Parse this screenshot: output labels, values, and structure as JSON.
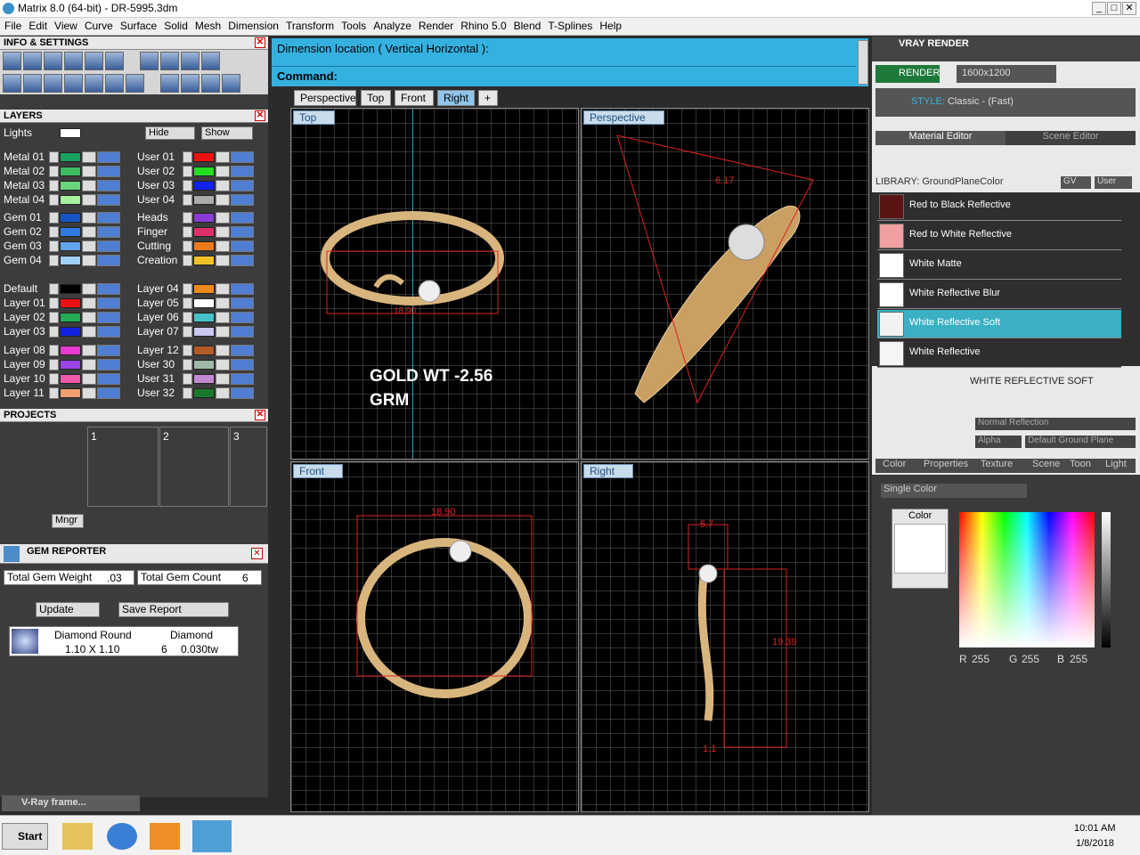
{
  "app": {
    "title": "Matrix 8.0 (64-bit) - DR-5995.3dm"
  },
  "menu": [
    "File",
    "Edit",
    "View",
    "Curve",
    "Surface",
    "Solid",
    "Mesh",
    "Dimension",
    "Transform",
    "Tools",
    "Analyze",
    "Render",
    "Rhino 5.0",
    "Blend",
    "T-Splines",
    "Help"
  ],
  "info": {
    "header": "INFO & SETTINGS"
  },
  "layers": {
    "header": "LAYERS",
    "lights": "Lights",
    "hide": "Hide",
    "show": "Show",
    "group1": [
      {
        "n": "Metal 01",
        "c": "#1aa060"
      },
      {
        "n": "Metal 02",
        "c": "#3cbb60"
      },
      {
        "n": "Metal 03",
        "c": "#6ad67b"
      },
      {
        "n": "Metal 04",
        "c": "#a8efa0"
      }
    ],
    "group1b": [
      {
        "n": "User 01",
        "c": "#ee1111"
      },
      {
        "n": "User 02",
        "c": "#22dd22"
      },
      {
        "n": "User 03",
        "c": "#1122ee"
      },
      {
        "n": "User 04",
        "c": "#aaaaaa"
      }
    ],
    "group2": [
      {
        "n": "Gem 01",
        "c": "#1755c7"
      },
      {
        "n": "Gem 02",
        "c": "#2f7ae0"
      },
      {
        "n": "Gem 03",
        "c": "#62a4ee"
      },
      {
        "n": "Gem 04",
        "c": "#9fd0f6"
      }
    ],
    "group2b": [
      {
        "n": "Heads",
        "c": "#8a3dd6"
      },
      {
        "n": "Finger",
        "c": "#dd2f66"
      },
      {
        "n": "Cutting",
        "c": "#ee7a1c"
      },
      {
        "n": "Creation",
        "c": "#f2c224"
      }
    ],
    "group3": [
      {
        "n": "Default",
        "c": "#000000"
      },
      {
        "n": "Layer 01",
        "c": "#ee1111"
      },
      {
        "n": "Layer 02",
        "c": "#22aa55"
      },
      {
        "n": "Layer 03",
        "c": "#1122dd"
      }
    ],
    "group3b": [
      {
        "n": "Layer 04",
        "c": "#ee8a1c"
      },
      {
        "n": "Layer 05",
        "c": "#ffffff"
      },
      {
        "n": "Layer 06",
        "c": "#46c3c8"
      },
      {
        "n": "Layer 07",
        "c": "#c8c8f0"
      }
    ],
    "group4": [
      {
        "n": "Layer 08",
        "c": "#e83ad0"
      },
      {
        "n": "Layer 09",
        "c": "#9b44e8"
      },
      {
        "n": "Layer 10",
        "c": "#ee5aaa"
      },
      {
        "n": "Layer 11",
        "c": "#f0a070"
      }
    ],
    "group4b": [
      {
        "n": "Layer 12",
        "c": "#b45a28"
      },
      {
        "n": "User 30",
        "c": "#9fb8a8"
      },
      {
        "n": "User 31",
        "c": "#c28ad0"
      },
      {
        "n": "User 32",
        "c": "#1a7a2a"
      }
    ]
  },
  "projects": {
    "header": "PROJECTS",
    "slots": [
      "1",
      "2",
      "3"
    ],
    "mngr": "Mngr"
  },
  "gem": {
    "header": "GEM REPORTER",
    "weight_label": "Total Gem Weight",
    "weight": ".03",
    "count_label": "Total Gem Count",
    "count": "6",
    "update": "Update",
    "save": "Save Report",
    "col1": "Diamond Round",
    "col2": "Diamond",
    "size": "1.10 X 1.10",
    "qty": "6",
    "wt": "0.030tw"
  },
  "vray_frame": "V-Ray frame...",
  "cmd": {
    "line1": "Dimension location ( Vertical  Horizontal ):",
    "line2": "Command:"
  },
  "tabs": [
    "Perspective",
    "Top",
    "Front",
    "Right"
  ],
  "viewports": {
    "top": "Top",
    "persp": "Perspective",
    "front": "Front",
    "right": "Right"
  },
  "annot": {
    "gold1": "GOLD WT -2.56",
    "gold2": "GRM",
    "d_top": "18.90",
    "d_front": "18.90",
    "d_right1": "5.7",
    "d_right2": "19.39",
    "d_right3": "1.1",
    "d_persp": "6.17"
  },
  "vray": {
    "title": "VRAY RENDER",
    "render": "RENDER",
    "res": "1600x1200",
    "style_label": "STYLE:",
    "style": "Classic - (Fast)",
    "tab_mat": "Material Editor",
    "tab_scene": "Scene Editor",
    "library": "LIBRARY: GroundPlaneColor",
    "gv": "GV",
    "user": "User",
    "materials": [
      {
        "n": "Red to Black Reflective",
        "c": "#5a1414"
      },
      {
        "n": "Red to White Reflective",
        "c": "#f0a0a0"
      },
      {
        "n": "White Matte",
        "c": "#ffffff"
      },
      {
        "n": "White Reflective Blur",
        "c": "#ffffff"
      },
      {
        "n": "White Reflective Soft",
        "c": "#f2f2f2"
      },
      {
        "n": "White Reflective",
        "c": "#f5f5f5"
      }
    ],
    "selected": "WHITE REFLECTIVE SOFT",
    "refl": "Normal Reflection",
    "alpha": "Alpha",
    "ground": "Default Ground Plane",
    "proptabs": [
      "Color",
      "Properties",
      "Texture",
      "Scene",
      "Toon",
      "Light"
    ],
    "single": "Single Color",
    "color_label": "Color",
    "r": "255",
    "g": "255",
    "b": "255"
  },
  "taskbar": {
    "start": "Start",
    "time": "10:01 AM",
    "date": "1/8/2018"
  }
}
